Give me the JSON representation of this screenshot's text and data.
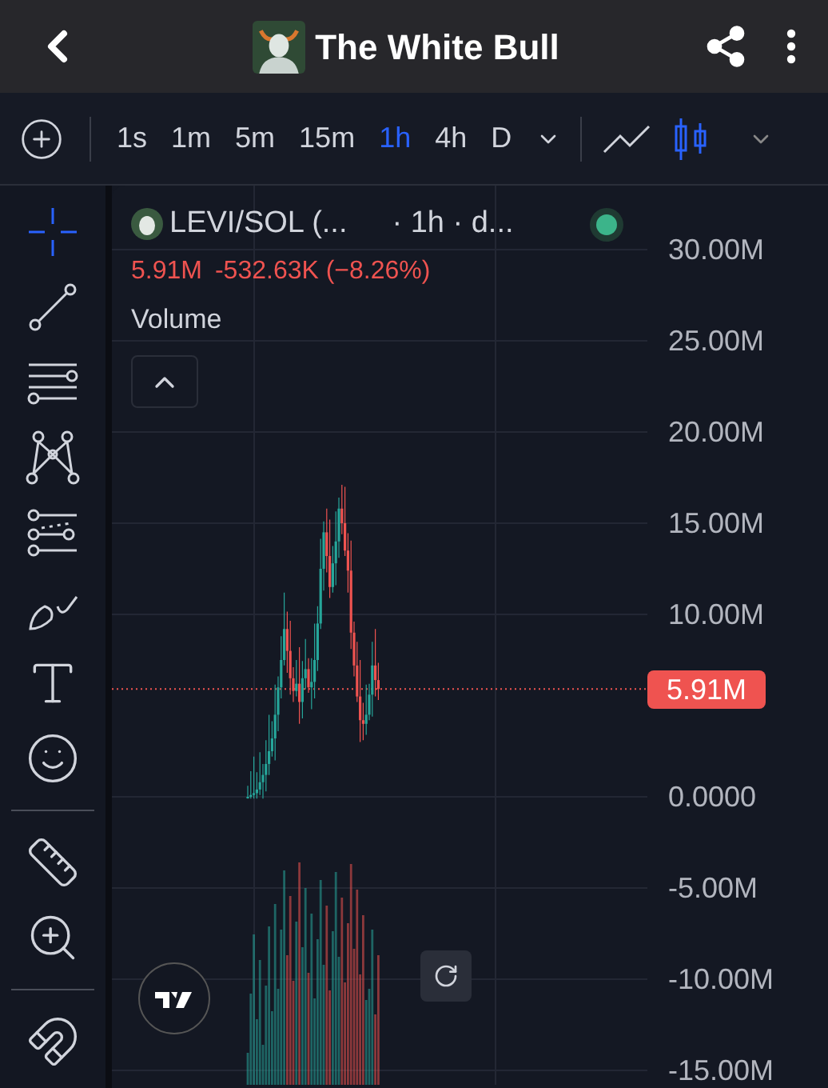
{
  "header": {
    "title": "The White Bull"
  },
  "toolbar": {
    "intervals": [
      {
        "label": "1s",
        "selected": false
      },
      {
        "label": "1m",
        "selected": false
      },
      {
        "label": "5m",
        "selected": false
      },
      {
        "label": "15m",
        "selected": false
      },
      {
        "label": "1h",
        "selected": true
      },
      {
        "label": "4h",
        "selected": false
      },
      {
        "label": "D",
        "selected": false
      }
    ],
    "chart_types": [
      {
        "kind": "line",
        "selected": false
      },
      {
        "kind": "candles",
        "selected": true
      }
    ]
  },
  "tools": [
    {
      "kind": "crosshair",
      "selected": true
    },
    {
      "kind": "trend-line",
      "selected": false
    },
    {
      "kind": "horizontal-lines",
      "selected": false
    },
    {
      "kind": "pattern",
      "selected": false
    },
    {
      "kind": "fib",
      "selected": false
    },
    {
      "kind": "brush",
      "selected": false
    },
    {
      "kind": "text",
      "selected": false
    },
    {
      "kind": "emoji",
      "selected": false
    },
    {
      "kind": "divider"
    },
    {
      "kind": "ruler",
      "selected": false
    },
    {
      "kind": "zoom",
      "selected": false
    },
    {
      "kind": "divider"
    },
    {
      "kind": "magnet",
      "selected": false
    }
  ],
  "legend": {
    "symbol": "LEVI/SOL (...",
    "interval": "· 1h · d...",
    "last": "5.91M",
    "change": "-532.63K (−8.26%)",
    "indicator": "Volume"
  },
  "axis_labels": [
    "30.00M",
    "25.00M",
    "20.00M",
    "15.00M",
    "10.00M",
    "0.0000",
    "-5.00M",
    "-10.00M",
    "-15.00M"
  ],
  "price_badge": "5.91M"
}
